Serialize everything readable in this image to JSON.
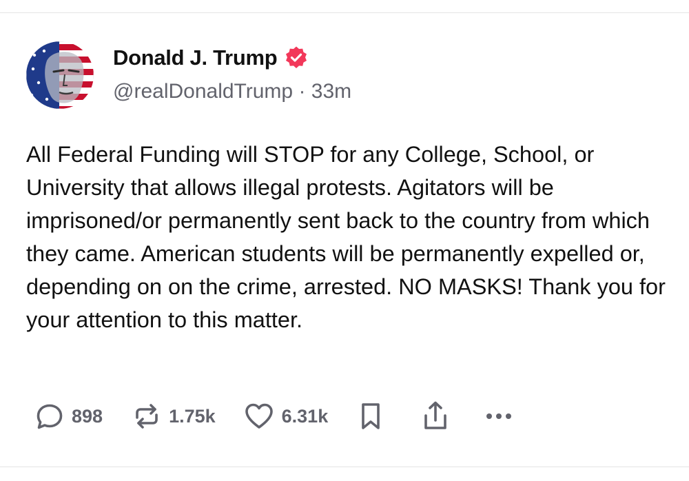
{
  "post": {
    "author": {
      "display_name": "Donald J. Trump",
      "handle": "@realDonaldTrump",
      "separator": "·",
      "time_ago": "33m",
      "verified": true,
      "avatar_icon": "avatar-image"
    },
    "body": "All Federal Funding will STOP for any College, School, or University that allows illegal protests. Agitators will be imprisoned/or permanently sent back to the country from which they came. American students will be permanently expelled or, depending on on the crime, arrested. NO MASKS! Thank you for your attention to this matter.",
    "actions": {
      "reply": {
        "icon": "reply-icon",
        "count": "898"
      },
      "repost": {
        "icon": "repost-icon",
        "count": "1.75k"
      },
      "like": {
        "icon": "heart-icon",
        "count": "6.31k"
      },
      "bookmark": {
        "icon": "bookmark-icon"
      },
      "share": {
        "icon": "share-icon"
      },
      "more": {
        "icon": "more-icon"
      }
    }
  },
  "colors": {
    "text_primary": "#111111",
    "text_secondary": "#62636c",
    "verified_badge": "#f2385a",
    "divider": "#e4e4e4"
  }
}
